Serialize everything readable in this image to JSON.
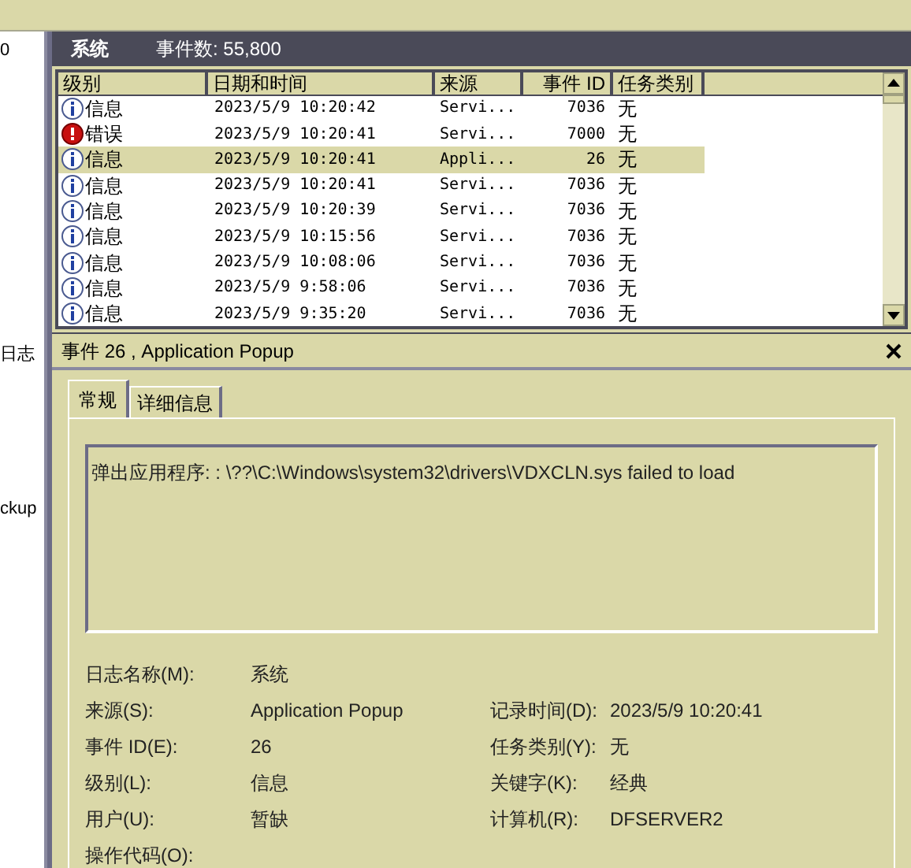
{
  "left_panel": {
    "items": [
      "0",
      "日志",
      "ckup"
    ]
  },
  "log_header": {
    "title": "系统",
    "count": "事件数: 55,800"
  },
  "table": {
    "columns": [
      "级别",
      "日期和时间",
      "来源",
      "事件 ID",
      "任务类别"
    ],
    "rows": [
      {
        "kind": "info",
        "level_text": "信息",
        "datetime": "2023/5/9 10:20:42",
        "source": "Servi...",
        "event_id": "7036",
        "task": "无",
        "selected": false
      },
      {
        "kind": "error",
        "level_text": "错误",
        "datetime": "2023/5/9 10:20:41",
        "source": "Servi...",
        "event_id": "7000",
        "task": "无",
        "selected": false
      },
      {
        "kind": "info",
        "level_text": "信息",
        "datetime": "2023/5/9 10:20:41",
        "source": "Appli...",
        "event_id": "26",
        "task": "无",
        "selected": true
      },
      {
        "kind": "info",
        "level_text": "信息",
        "datetime": "2023/5/9 10:20:41",
        "source": "Servi...",
        "event_id": "7036",
        "task": "无",
        "selected": false
      },
      {
        "kind": "info",
        "level_text": "信息",
        "datetime": "2023/5/9 10:20:39",
        "source": "Servi...",
        "event_id": "7036",
        "task": "无",
        "selected": false
      },
      {
        "kind": "info",
        "level_text": "信息",
        "datetime": "2023/5/9 10:15:56",
        "source": "Servi...",
        "event_id": "7036",
        "task": "无",
        "selected": false
      },
      {
        "kind": "info",
        "level_text": "信息",
        "datetime": "2023/5/9 10:08:06",
        "source": "Servi...",
        "event_id": "7036",
        "task": "无",
        "selected": false
      },
      {
        "kind": "info",
        "level_text": "信息",
        "datetime": "2023/5/9 9:58:06",
        "source": "Servi...",
        "event_id": "7036",
        "task": "无",
        "selected": false
      },
      {
        "kind": "info",
        "level_text": "信息",
        "datetime": "2023/5/9 9:35:20",
        "source": "Servi...",
        "event_id": "7036",
        "task": "无",
        "selected": false
      }
    ]
  },
  "detail": {
    "title": "事件 26 , Application Popup",
    "tabs": [
      {
        "label": "常规",
        "selected": true
      },
      {
        "label": "详细信息",
        "selected": false
      }
    ],
    "message": "弹出应用程序: : \\??\\C:\\Windows\\system32\\drivers\\VDXCLN.sys failed to load",
    "properties": [
      {
        "label": "日志名称(M):",
        "value": "系统"
      },
      {
        "label": "来源(S):",
        "value": "Application Popup",
        "label2": "记录时间(D):",
        "value2": "2023/5/9 10:20:41"
      },
      {
        "label": "事件 ID(E):",
        "value": "26",
        "label2": "任务类别(Y):",
        "value2": "无"
      },
      {
        "label": "级别(L):",
        "value": "信息",
        "label2": "关键字(K):",
        "value2": "经典"
      },
      {
        "label": "用户(U):",
        "value": "暂缺",
        "label2": "计算机(R):",
        "value2": "DFSERVER2"
      },
      {
        "label": "操作代码(O):"
      }
    ]
  }
}
